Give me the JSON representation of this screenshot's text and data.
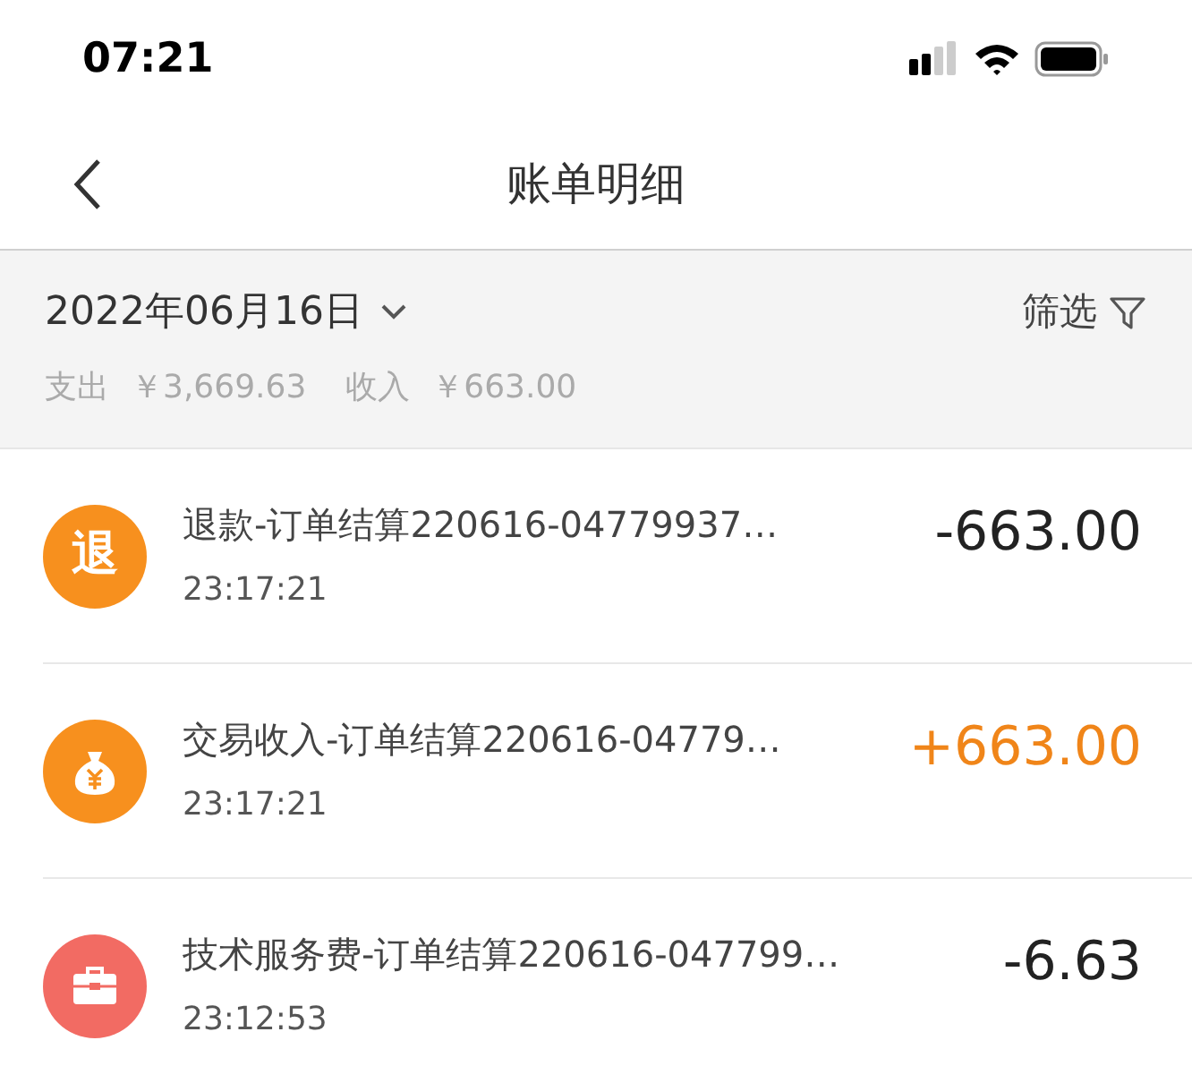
{
  "status_bar": {
    "time": "07:21"
  },
  "nav": {
    "title": "账单明细"
  },
  "summary": {
    "date": "2022年06月16日",
    "filter": "筛选",
    "expense_label": "支出",
    "expense": "￥3,669.63",
    "income_label": "收入",
    "income": "￥663.00"
  },
  "records": [
    {
      "kind": "refund",
      "icon_label": "退",
      "color": "#f7901e",
      "title": "退款-订单结算220616-04779937…",
      "time": "23:17:21",
      "amount": "-663.00",
      "income": false
    },
    {
      "kind": "income",
      "color": "#f7901e",
      "title": "交易收入-订单结算220616-04779…",
      "time": "23:17:21",
      "amount": "+663.00",
      "income": true
    },
    {
      "kind": "fee",
      "color": "#f26b63",
      "title": "技术服务费-订单结算220616-047799…",
      "time": "23:12:53",
      "amount": "-6.63",
      "income": false
    }
  ]
}
